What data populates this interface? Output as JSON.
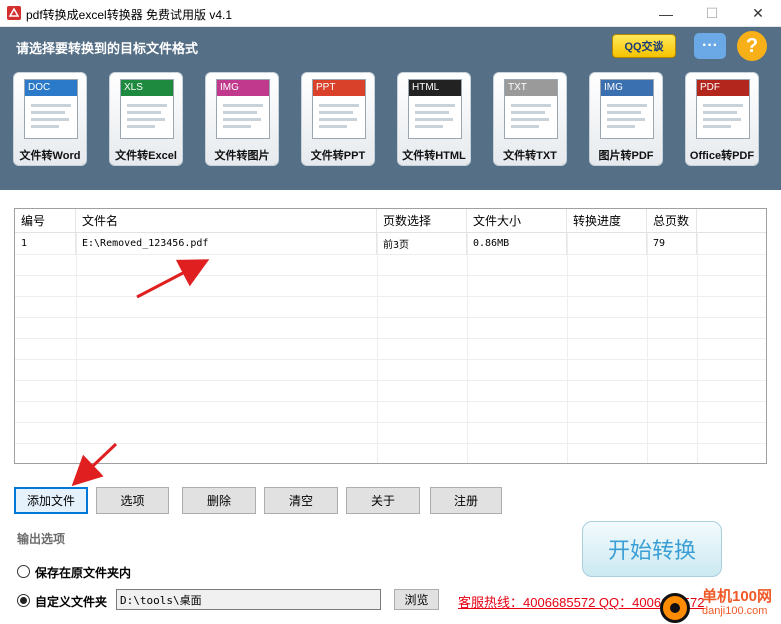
{
  "window": {
    "title": "pdf转换成excel转换器 免费试用版 v4.1",
    "min_glyph": "—",
    "max_glyph": "☐",
    "close_glyph": "✕"
  },
  "header": {
    "prompt": "请选择要转换到的目标文件格式",
    "qq_label": "QQ交谈",
    "chat_glyph": "···",
    "help_glyph": "?"
  },
  "formats": [
    {
      "tag": "DOC",
      "label": "文件转Word",
      "color": "#2b79c9"
    },
    {
      "tag": "XLS",
      "label": "文件转Excel",
      "color": "#1e8a3f"
    },
    {
      "tag": "IMG",
      "label": "文件转图片",
      "color": "#c0398c"
    },
    {
      "tag": "PPT",
      "label": "文件转PPT",
      "color": "#d9412b"
    },
    {
      "tag": "HTML",
      "label": "文件转HTML",
      "color": "#222222"
    },
    {
      "tag": "TXT",
      "label": "文件转TXT",
      "color": "#9a9a9a"
    },
    {
      "tag": "IMG",
      "label": "图片转PDF",
      "color": "#3a6fb0"
    },
    {
      "tag": "PDF",
      "label": "Office转PDF",
      "color": "#b3261e"
    }
  ],
  "table": {
    "columns": [
      "编号",
      "文件名",
      "页数选择",
      "文件大小",
      "转换进度",
      "总页数",
      ""
    ],
    "rows": [
      [
        "1",
        "E:\\Removed_123456.pdf",
        "前3页",
        "0.86MB",
        "",
        "79",
        ""
      ]
    ]
  },
  "buttons": {
    "add": "添加文件",
    "options": "选项",
    "delete": "删除",
    "clear": "清空",
    "about": "关于",
    "register": "注册"
  },
  "output": {
    "title": "输出选项",
    "option_same_folder": "保存在原文件夹内",
    "option_custom_folder": "自定义文件夹",
    "custom_path": "D:\\tools\\桌面",
    "browse": "浏览",
    "selected": "custom"
  },
  "start_label": "开始转换",
  "hotline": "客服热线：4006685572 QQ：4006685572",
  "watermark": {
    "cn": "单机100网",
    "en": "danji100.com"
  },
  "colors": {
    "header_bg": "#556f86",
    "hotline": "#e60012",
    "start_text": "#3b9fd6",
    "annotation_arrow": "#e02020"
  }
}
